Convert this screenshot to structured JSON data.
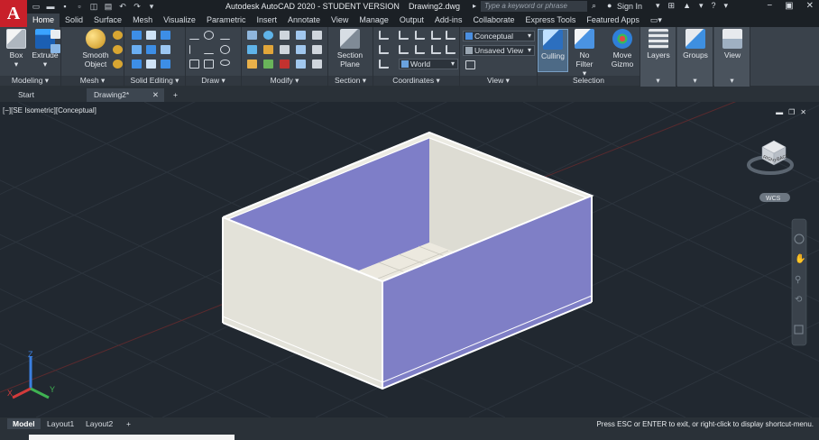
{
  "app": {
    "logo": "A",
    "title": "Autodesk AutoCAD 2020 - STUDENT VERSION",
    "filename": "Drawing2.dwg",
    "search_placeholder": "Type a keyword or phrase",
    "sign_in": "Sign In"
  },
  "ribbon_tabs": [
    "Home",
    "Solid",
    "Surface",
    "Mesh",
    "Visualize",
    "Parametric",
    "Insert",
    "Annotate",
    "View",
    "Manage",
    "Output",
    "Add-ins",
    "Collaborate",
    "Express Tools",
    "Featured Apps"
  ],
  "ribbon": {
    "box": "Box",
    "extrude": "Extrude",
    "smooth_object_1": "Smooth",
    "smooth_object_2": "Object",
    "section_plane_1": "Section",
    "section_plane_2": "Plane",
    "culling": "Culling",
    "no_filter": "No Filter",
    "move_gizmo_1": "Move",
    "move_gizmo_2": "Gizmo",
    "layers": "Layers",
    "groups": "Groups",
    "view": "View",
    "visual_style": "Conceptual",
    "named_view": "Unsaved View",
    "ucs": "World",
    "panels": {
      "modeling": "Modeling",
      "mesh": "Mesh",
      "solid_editing": "Solid Editing",
      "draw": "Draw",
      "modify": "Modify",
      "section": "Section",
      "coordinates": "Coordinates",
      "view": "View",
      "selection": "Selection"
    }
  },
  "file_tabs": [
    "Start",
    "Drawing2*"
  ],
  "viewport": {
    "label": "[−][SE Isometric][Conceptual]",
    "viewcube_faces": [
      "RIGHT",
      "BACK"
    ],
    "wcs": "WCS",
    "axes": [
      "X",
      "Y",
      "Z"
    ]
  },
  "layout_tabs": [
    "Model",
    "Layout1",
    "Layout2"
  ],
  "status_message": "Press ESC or ENTER to exit, or right-click to display shortcut-menu.",
  "colors": {
    "accent": "#c8202a",
    "box_light": "#e3e2d9",
    "box_purple": "#7f7fc6",
    "viewport_bg": "#212830"
  }
}
